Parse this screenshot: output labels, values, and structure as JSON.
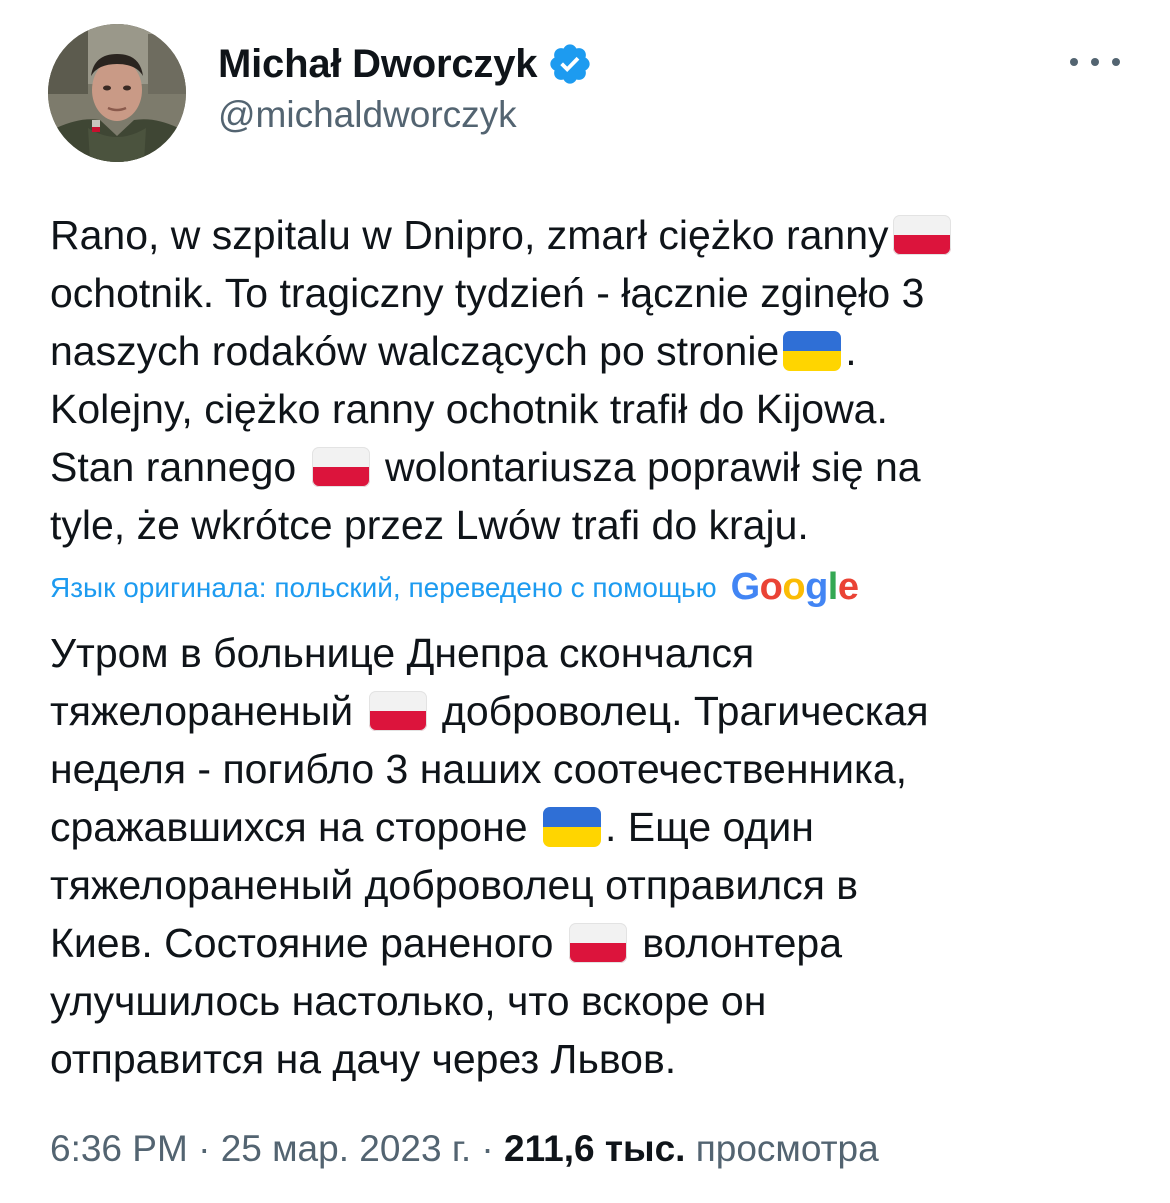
{
  "author": {
    "display_name": "Michał Dworczyk",
    "handle": "@michaldworczyk",
    "verified": true,
    "verified_color": "#1d9bf0",
    "avatar_icon": "profile-photo"
  },
  "more_icon": "more-horizontal-icon",
  "tweet": {
    "lines": [
      {
        "a": "Rano, w szpitalu w Dnipro, zmarł ciężko ranny",
        "flag": "pl",
        "b": ""
      },
      {
        "a": "ochotnik. To tragiczny tydzień - łącznie zginęło 3",
        "flag": "",
        "b": ""
      },
      {
        "a": "naszych rodaków walczących po stronie",
        "flag": "ua",
        "b": "."
      },
      {
        "a": "Kolejny, ciężko ranny ochotnik trafił do Kijowa.",
        "flag": "",
        "b": ""
      },
      {
        "a": "Stan rannego ",
        "flag": "pl",
        "b": " wolontariusza poprawił się na"
      },
      {
        "a": "tyle, że wkrótce przez Lwów trafi do kraju.",
        "flag": "",
        "b": ""
      }
    ]
  },
  "translation": {
    "note": "Язык оригинала: польский, переведено с помощью",
    "provider_logo": "Google",
    "lines": [
      {
        "a": "Утром в больнице Днепра скончался",
        "flag": "",
        "b": ""
      },
      {
        "a": "тяжелораненый ",
        "flag": "pl",
        "b": " доброволец. Трагическая"
      },
      {
        "a": "неделя - погибло 3 наших соотечественника,",
        "flag": "",
        "b": ""
      },
      {
        "a": "сражавшихся на стороне ",
        "flag": "ua",
        "b": ". Еще один"
      },
      {
        "a": "тяжелораненый доброволец отправился в",
        "flag": "",
        "b": ""
      },
      {
        "a": "Киев. Состояние раненого ",
        "flag": "pl",
        "b": " волонтера"
      },
      {
        "a": "улучшилось настолько, что вскоре он",
        "flag": "",
        "b": ""
      },
      {
        "a": "отправится на дачу через Львов.",
        "flag": "",
        "b": ""
      }
    ]
  },
  "meta": {
    "time": "6:36 PM",
    "sep1": " · ",
    "date": "25 мар. 2023 г.",
    "sep2": " · ",
    "views_count": "211,6 тыс.",
    "views_label": " просмотра"
  },
  "colors": {
    "text": "#0f1419",
    "secondary": "#536471",
    "link": "#1d9bf0",
    "flag_pl_white": "#f2f2f2",
    "flag_pl_red": "#dc143c",
    "flag_ua_blue": "#2f6fd6",
    "flag_ua_yellow": "#ffd500"
  }
}
